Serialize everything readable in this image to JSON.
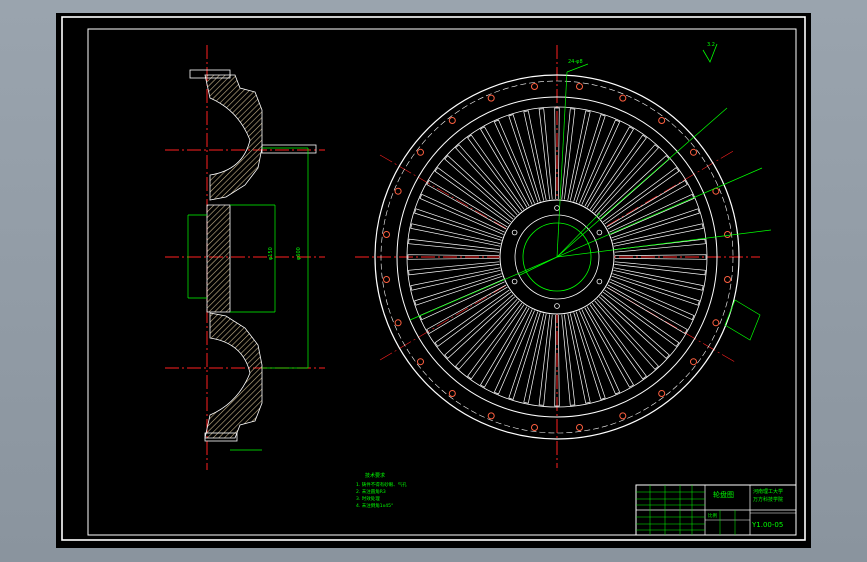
{
  "drawing": {
    "title_block": {
      "drawing_name": "轮盘图",
      "school_line1": "河南理工大学",
      "school_line2": "万方科技学院",
      "scale_label": "比例",
      "drawing_number": "Y1.00-05"
    },
    "tech_requirements": {
      "heading": "技术要求",
      "items": [
        "1. 铸件不得有砂眼、气孔",
        "2. 未注圆角R3",
        "3. 时效处理",
        "4. 未注倒角1x45°"
      ]
    },
    "annotations": {
      "bolt_holes": "24-φ8",
      "surface_finish": "3.2",
      "dim_phi_inner": "φ150",
      "dim_phi_outer": "φ600"
    },
    "colors": {
      "background": "#000000",
      "outline": "#ffffff",
      "centerline": "#ff2020",
      "dimension": "#00ff00",
      "hatch": "#c8b48a",
      "hole_ring": "#ff6040"
    },
    "counts": {
      "blades": 60,
      "bolt_holes": 24,
      "hub_holes": 6
    }
  }
}
